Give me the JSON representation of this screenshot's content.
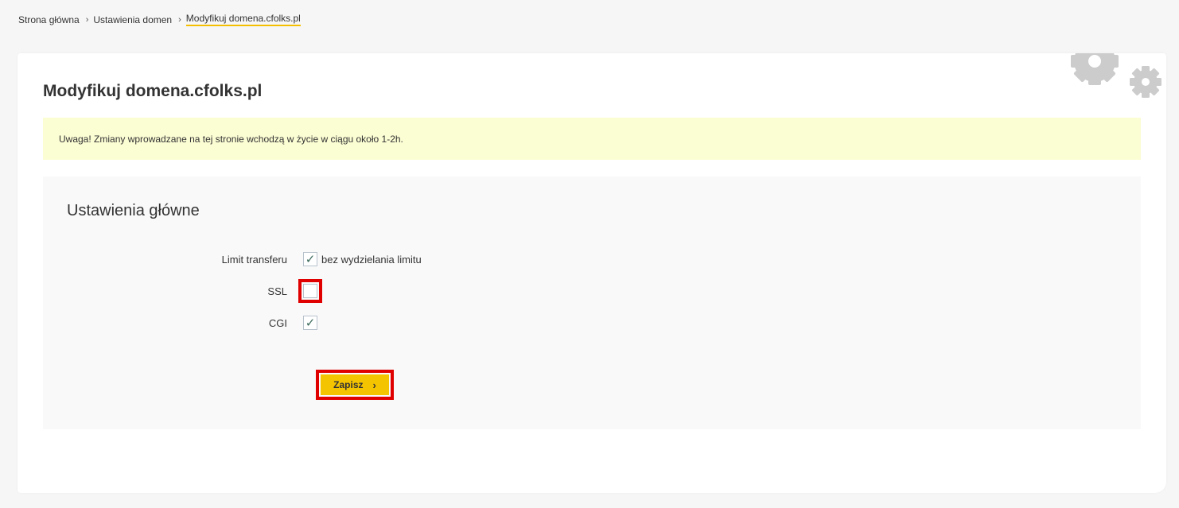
{
  "breadcrumb": {
    "items": [
      "Strona główna",
      "Ustawienia domen",
      "Modyfikuj domena.cfolks.pl"
    ],
    "separator": "›"
  },
  "page": {
    "title": "Modyfikuj domena.cfolks.pl",
    "notice": "Uwaga! Zmiany wprowadzane na tej stronie wchodzą w życie w ciągu około 1-2h."
  },
  "settings": {
    "section_title": "Ustawienia główne",
    "fields": [
      {
        "label": "Limit transferu",
        "checked": true,
        "checkbox_label": "bez wydzielania limitu"
      },
      {
        "label": "SSL",
        "checked": false,
        "checkbox_label": ""
      },
      {
        "label": "CGI",
        "checked": true,
        "checkbox_label": ""
      }
    ],
    "check_glyph": "✓",
    "save_label": "Zapisz",
    "save_icon": "›"
  },
  "colors": {
    "accent": "#f5c400",
    "notice_bg": "#fbfdd3",
    "highlight": "#e00000"
  },
  "icons": {
    "decor": "gears-icon"
  }
}
